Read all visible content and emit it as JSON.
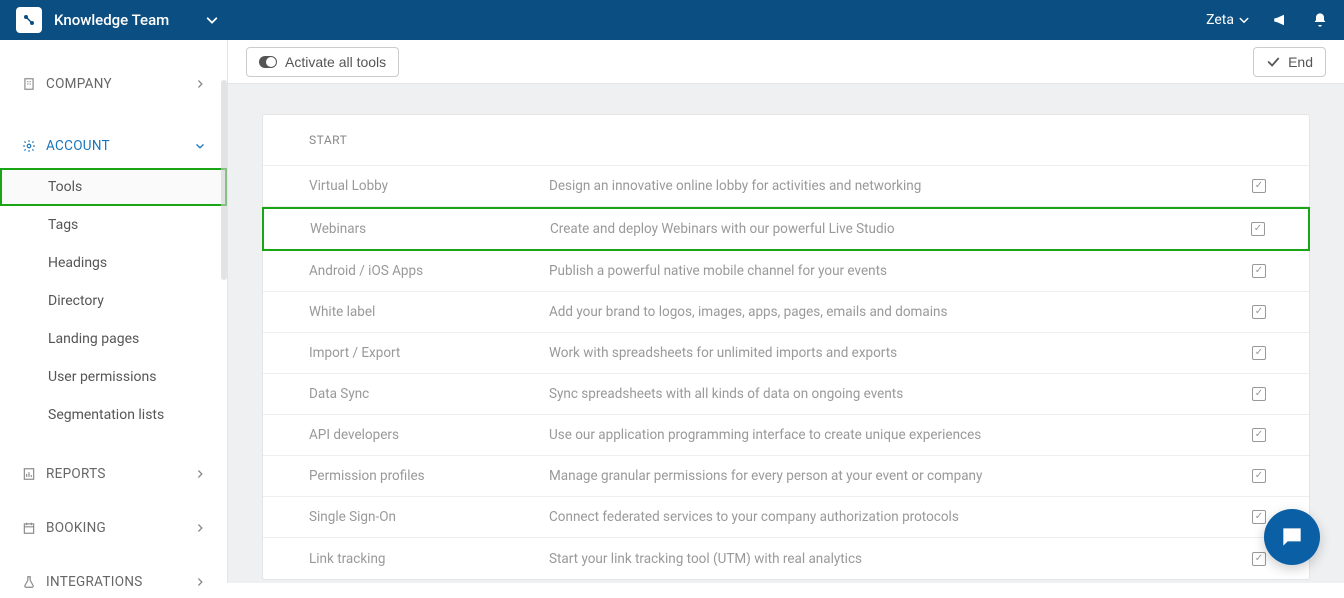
{
  "header": {
    "team_name": "Knowledge Team",
    "user_name": "Zeta"
  },
  "sidebar": {
    "company_label": "COMPANY",
    "account_label": "ACCOUNT",
    "reports_label": "REPORTS",
    "booking_label": "BOOKING",
    "integrations_label": "INTEGRATIONS",
    "account_items": [
      {
        "label": "Tools",
        "active": true
      },
      {
        "label": "Tags"
      },
      {
        "label": "Headings"
      },
      {
        "label": "Directory"
      },
      {
        "label": "Landing pages"
      },
      {
        "label": "User permissions"
      },
      {
        "label": "Segmentation lists"
      }
    ]
  },
  "actionbar": {
    "activate_all_label": "Activate all tools",
    "end_label": "End"
  },
  "table": {
    "header": "START",
    "rows": [
      {
        "name": "Virtual Lobby",
        "desc": "Design an innovative online lobby for activities and networking",
        "checked": true
      },
      {
        "name": "Webinars",
        "desc": "Create and deploy Webinars with our powerful Live Studio",
        "checked": true,
        "highlight": true
      },
      {
        "name": "Android / iOS Apps",
        "desc": "Publish a powerful native mobile channel for your events",
        "checked": true
      },
      {
        "name": "White label",
        "desc": "Add your brand to logos, images, apps, pages, emails and domains",
        "checked": true
      },
      {
        "name": "Import / Export",
        "desc": "Work with spreadsheets for unlimited imports and exports",
        "checked": true
      },
      {
        "name": "Data Sync",
        "desc": "Sync spreadsheets with all kinds of data on ongoing events",
        "checked": true
      },
      {
        "name": "API developers",
        "desc": "Use our application programming interface to create unique experiences",
        "checked": true
      },
      {
        "name": "Permission profiles",
        "desc": "Manage granular permissions for every person at your event or company",
        "checked": true
      },
      {
        "name": "Single Sign-On",
        "desc": "Connect federated services to your company authorization protocols",
        "checked": true
      },
      {
        "name": "Link tracking",
        "desc": "Start your link tracking tool (UTM) with real analytics",
        "checked": true
      }
    ]
  }
}
